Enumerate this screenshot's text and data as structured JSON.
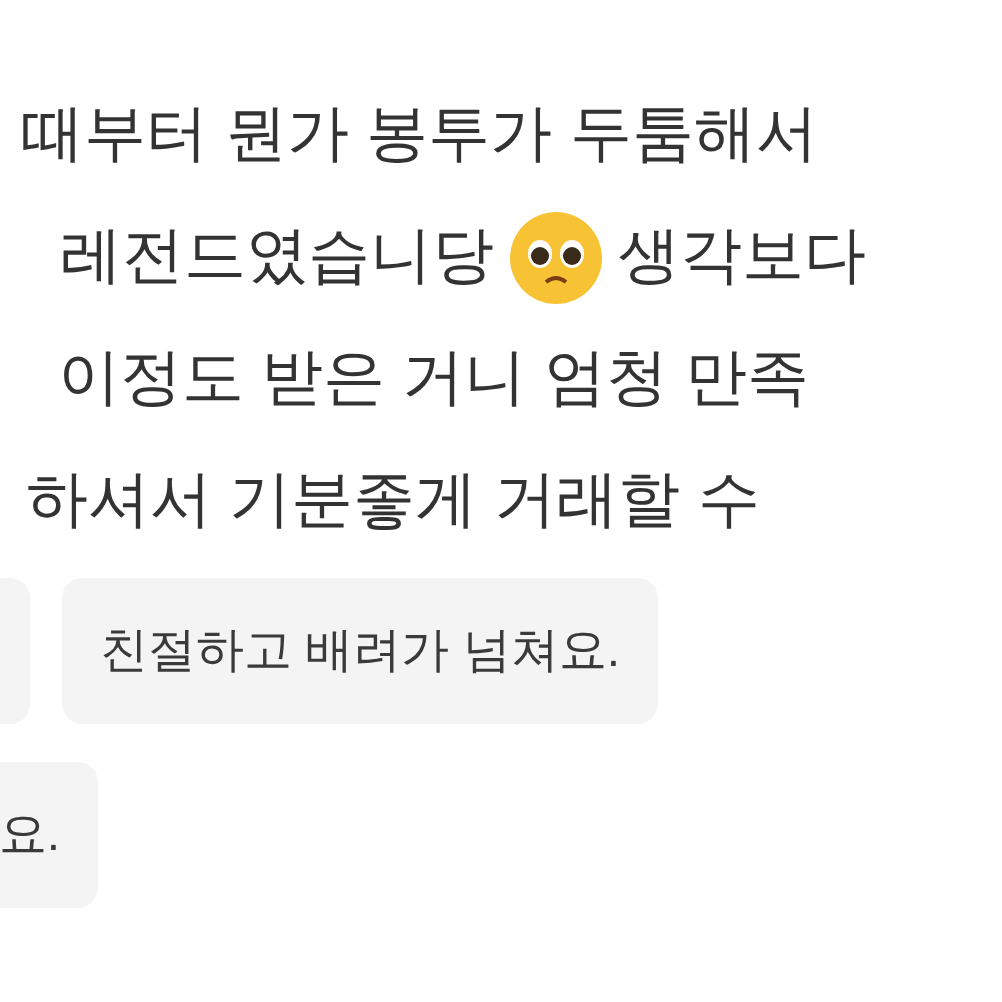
{
  "review_lines": [
    {
      "segments": [
        {
          "kind": "text",
          "text": "때부터 뭔가 봉투가 두툼해서"
        }
      ]
    },
    {
      "segments": [
        {
          "kind": "text",
          "text": "레전드였습니당"
        },
        {
          "kind": "emoji"
        },
        {
          "kind": "text",
          "text": "생각보다"
        }
      ]
    },
    {
      "segments": [
        {
          "kind": "text",
          "text": "이정도 받은 거니 엄청 만족"
        }
      ]
    },
    {
      "segments": [
        {
          "kind": "text",
          "text": "하셔서 기분좋게 거래할 수"
        }
      ]
    }
  ],
  "chip_rows": [
    [
      {
        "kind": "blank"
      },
      {
        "kind": "text",
        "text": "친절하고 배려가 넘쳐요."
      }
    ],
    [
      {
        "kind": "text",
        "text": "요."
      }
    ]
  ]
}
